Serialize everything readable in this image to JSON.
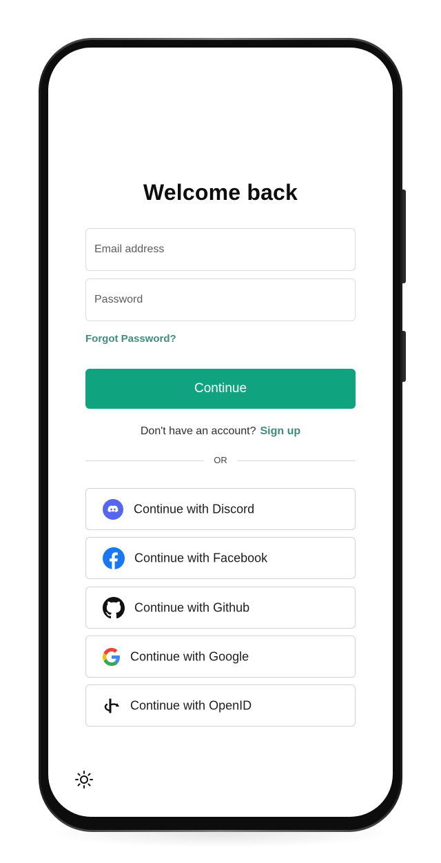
{
  "login": {
    "title": "Welcome back",
    "email_placeholder": "Email address",
    "password_placeholder": "Password",
    "forgot_password": "Forgot Password?",
    "continue_label": "Continue",
    "no_account_text": "Don't have an account?",
    "signup_link": "Sign up",
    "divider_text": "OR"
  },
  "social": {
    "discord": "Continue with Discord",
    "facebook": "Continue with Facebook",
    "github": "Continue with Github",
    "google": "Continue with Google",
    "openid": "Continue with OpenID"
  },
  "icons": {
    "discord": "discord-icon",
    "facebook": "facebook-icon",
    "github": "github-icon",
    "google": "google-icon",
    "openid": "openid-icon",
    "theme": "sun-icon"
  },
  "colors": {
    "accent": "#10a37f",
    "link": "#3c8f7c",
    "discord": "#5865f2",
    "facebook": "#1877f2"
  }
}
